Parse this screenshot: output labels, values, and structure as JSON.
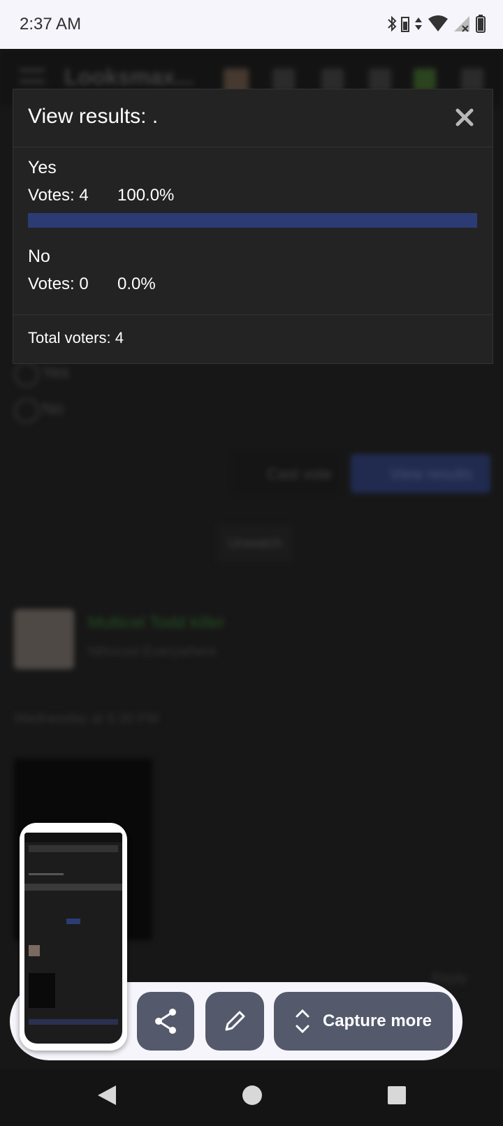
{
  "status_bar": {
    "time": "2:37 AM"
  },
  "background": {
    "logo_text": "Looksmax...",
    "poll_options": [
      "Yes",
      "No"
    ],
    "cast_vote_label": "Cast vote",
    "view_results_label": "View results",
    "unwatch_label": "Unwatch",
    "author_name": "Multicel Todd killer",
    "author_subtitle": "Nihrcool Everywhere",
    "post_date": "Wednesday at 5:30 PM",
    "reply_label": "Reply"
  },
  "modal": {
    "title": "View results: .",
    "options": [
      {
        "label": "Yes",
        "votes_text": "Votes: 4",
        "percent_text": "100.0%",
        "percent": 100
      },
      {
        "label": "No",
        "votes_text": "Votes: 0",
        "percent_text": "0.0%",
        "percent": 0
      }
    ],
    "total_voters": "Total voters: 4"
  },
  "screenshot_toolbar": {
    "capture_more_label": "Capture more",
    "share_icon": "share-icon",
    "edit_icon": "pencil-icon",
    "expand_icon": "expand-vertical-icon"
  },
  "colors": {
    "bar_fill": "#2c3b73",
    "toolbar_button": "#545a6c",
    "modal_bg": "#232323"
  }
}
